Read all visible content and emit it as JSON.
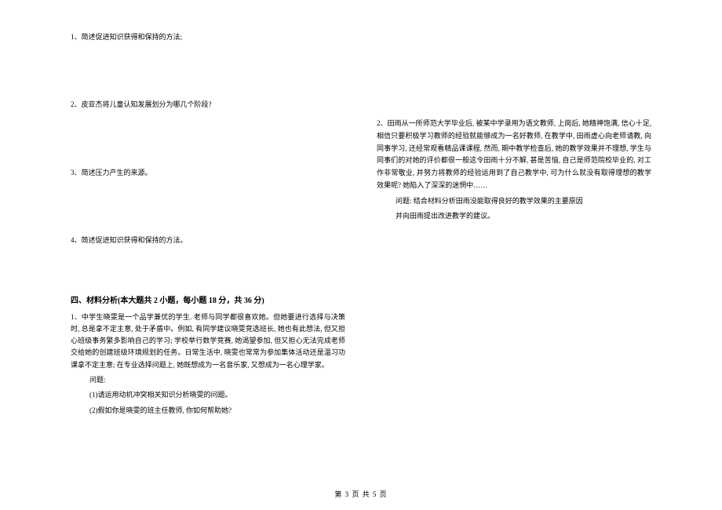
{
  "left": {
    "q1": "1、简述促进知识获得和保持的方法;",
    "q2": "2、皮亚杰将儿童认知发展划分为哪几个阶段?",
    "q3": "3、简述压力产生的来源。",
    "q4": "4、简述促进知识获得和保持的方法。",
    "section4_header": "四、材料分析(本大题共 2 小题，每小题 18 分，共 36 分)",
    "s4_q1_para": "1、中学生晓雯是一个品学兼优的学生. 老师与同学都很喜欢她。但她要进行选择与决策时, 总是拿不定主意, 处于矛盾中。例如, 有同学建议晓雯竞选班长, 她也有此想法, 但又担心班级事务繁多影响自己的学习; 学校举行数学竞赛, 她渴望参加, 但又担心无法完成老师交给她的创建班级环境规划的任务。日常生活中, 晓雯也常常为参加集体活动还是温习功课拿不定主意; 在专业选择问题上, 她既想成为一名音乐家, 又想成为一名心理学家。",
    "s4_q1_q_label": "问题:",
    "s4_q1_sub1": "(1)请运用动机冲突相关知识分析晓雯的问题。",
    "s4_q1_sub2": "(2)假如你是晓雯的班主任教师, 你如何帮助她?"
  },
  "right": {
    "s4_q2_para": "2、田雨从一所师范大学毕业后, 被某中学录用为语文教师, 上岗后, 她精神饱满, 信心十足, 相信只要积极学习教师的经验就能够成为一名好教师, 在教学中, 田雨虚心向老师请教, 向同事学习, 还经常观看精品课课程, 然而, 期中教学检查后, 她的教学效果并不理想, 学生与同事们的对她的评价都很一般这令田雨十分不解, 甚是苦恼, 自己是师范院校毕业的, 对工作非常敬业, 并努力将教师的经验运用到了自己教学中, 可为什么就没有取得理想的教学效果呢? 她陷入了深深的迷惘中……",
    "s4_q2_q1": "问题: 结合材料分析田雨没能取得良好的教学效果的主要原因",
    "s4_q2_q2": "并向田雨提出改进教学的建议。"
  },
  "footer": "第 3 页 共 5 页"
}
